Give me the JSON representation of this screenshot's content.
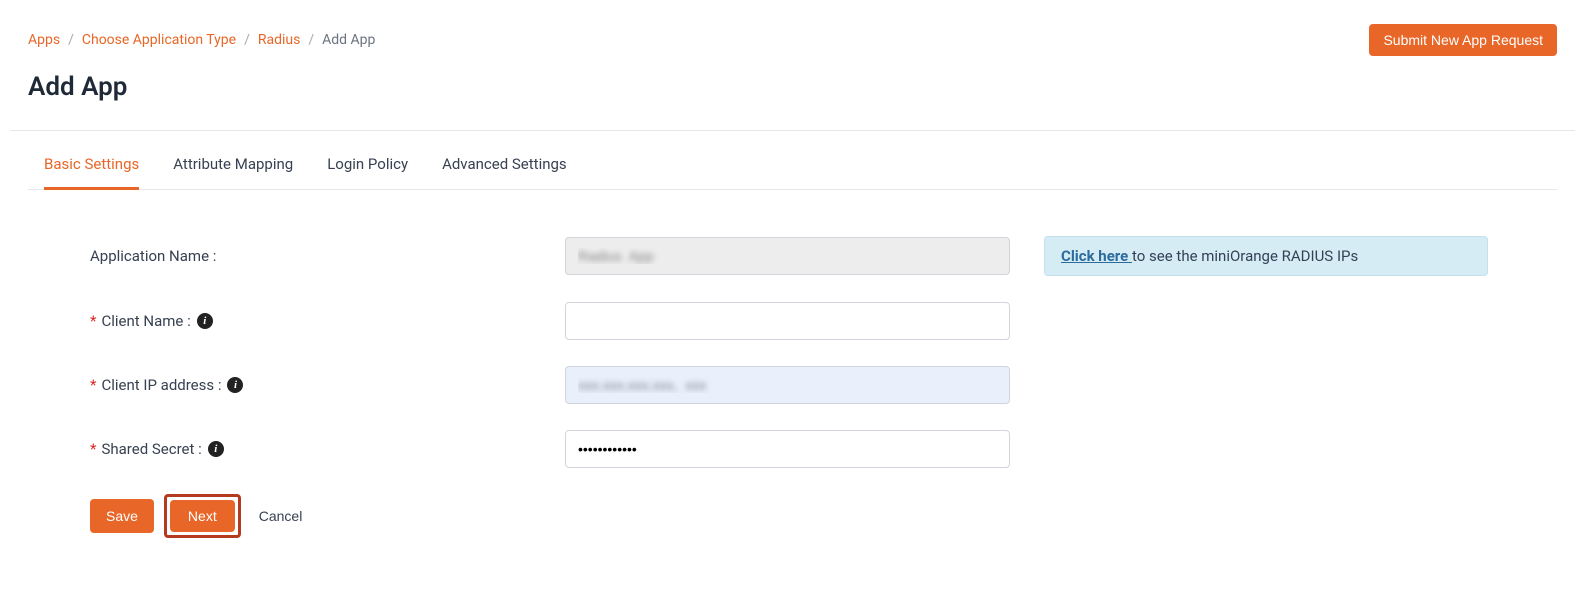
{
  "header": {
    "breadcrumbs": [
      {
        "label": "Apps",
        "link": true
      },
      {
        "label": "Choose Application Type",
        "link": true
      },
      {
        "label": "Radius",
        "link": true
      },
      {
        "label": "Add App",
        "link": false
      }
    ],
    "submit_label": "Submit New App Request",
    "page_title": "Add App"
  },
  "tabs": [
    {
      "id": "basic",
      "label": "Basic Settings",
      "active": true
    },
    {
      "id": "attr",
      "label": "Attribute Mapping",
      "active": false
    },
    {
      "id": "login",
      "label": "Login Policy",
      "active": false
    },
    {
      "id": "adv",
      "label": "Advanced Settings",
      "active": false
    }
  ],
  "form": {
    "app_name": {
      "label": "Application Name :",
      "value": "Radius  App"
    },
    "client_name": {
      "label": "Client Name :",
      "value": ""
    },
    "client_ip": {
      "label": "Client IP address :",
      "value": "xxx.xxx.xxx.xxx,  xxx"
    },
    "shared_secret": {
      "label": "Shared Secret :",
      "value": "••••••••••••"
    }
  },
  "info_box": {
    "link_text": "Click here ",
    "rest_text": "to see the miniOrange RADIUS IPs"
  },
  "actions": {
    "save": "Save",
    "next": "Next",
    "cancel": "Cancel"
  },
  "colors": {
    "accent": "#e86627",
    "info_bg": "#d5ecf5"
  }
}
